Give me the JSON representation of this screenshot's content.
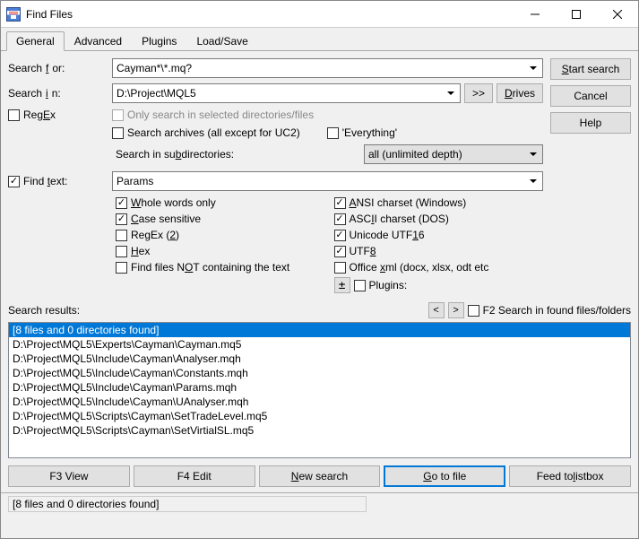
{
  "window": {
    "title": "Find Files"
  },
  "tabs": {
    "general": "General",
    "advanced": "Advanced",
    "plugins": "Plugins",
    "loadsave": "Load/Save"
  },
  "labels": {
    "search_for": "Search for:",
    "search_in": "Search in:",
    "regex": "RegEx",
    "find_text": "Find text:",
    "only_search_selected": "Only search in selected directories/files",
    "search_archives": "Search archives (all except for UC2)",
    "everything": "'Everything'",
    "search_subdirs": "Search in subdirectories:",
    "whole_words": "Whole words only",
    "case_sensitive": "Case sensitive",
    "regex2": "RegEx (2)",
    "hex": "Hex",
    "find_not_containing": "Find files NOT containing the text",
    "ansi": "ANSI charset (Windows)",
    "ascii": "ASCII charset (DOS)",
    "utf16": "Unicode UTF16",
    "utf8": "UTF8",
    "office_xml": "Office xml (docx, xlsx, odt etc.)",
    "plugins_cb": "Plugins:",
    "search_results": "Search results:",
    "f2_search_found": "F2 Search in found files/folders",
    "expand": ">>"
  },
  "values": {
    "search_for": "Cayman*\\*.mq?",
    "search_in": "D:\\Project\\MQL5",
    "find_text": "Params",
    "subdir_depth": "all (unlimited depth)"
  },
  "buttons": {
    "start_search": "Start search",
    "cancel": "Cancel",
    "help": "Help",
    "drives": "Drives",
    "f3_view": "F3 View",
    "f4_edit": "F4 Edit",
    "new_search": "New search",
    "go_to_file": "Go to file",
    "feed_to_listbox": "Feed to listbox"
  },
  "results": {
    "header": "[8 files and 0 directories found]",
    "items": [
      "D:\\Project\\MQL5\\Experts\\Cayman\\Cayman.mq5",
      "D:\\Project\\MQL5\\Include\\Cayman\\Analyser.mqh",
      "D:\\Project\\MQL5\\Include\\Cayman\\Constants.mqh",
      "D:\\Project\\MQL5\\Include\\Cayman\\Params.mqh",
      "D:\\Project\\MQL5\\Include\\Cayman\\UAnalyser.mqh",
      "D:\\Project\\MQL5\\Scripts\\Cayman\\SetTradeLevel.mq5",
      "D:\\Project\\MQL5\\Scripts\\Cayman\\SetVirtialSL.mq5"
    ]
  },
  "status": "[8 files and 0 directories found]",
  "checked": {
    "regex": false,
    "find_text": true,
    "only_selected": false,
    "archives": false,
    "everything": false,
    "whole_words": true,
    "case_sensitive": true,
    "regex2": false,
    "hex": false,
    "not_containing": false,
    "ansi": true,
    "ascii": true,
    "utf16": true,
    "utf8": true,
    "office_xml": false,
    "plugins": false,
    "f2": false
  }
}
